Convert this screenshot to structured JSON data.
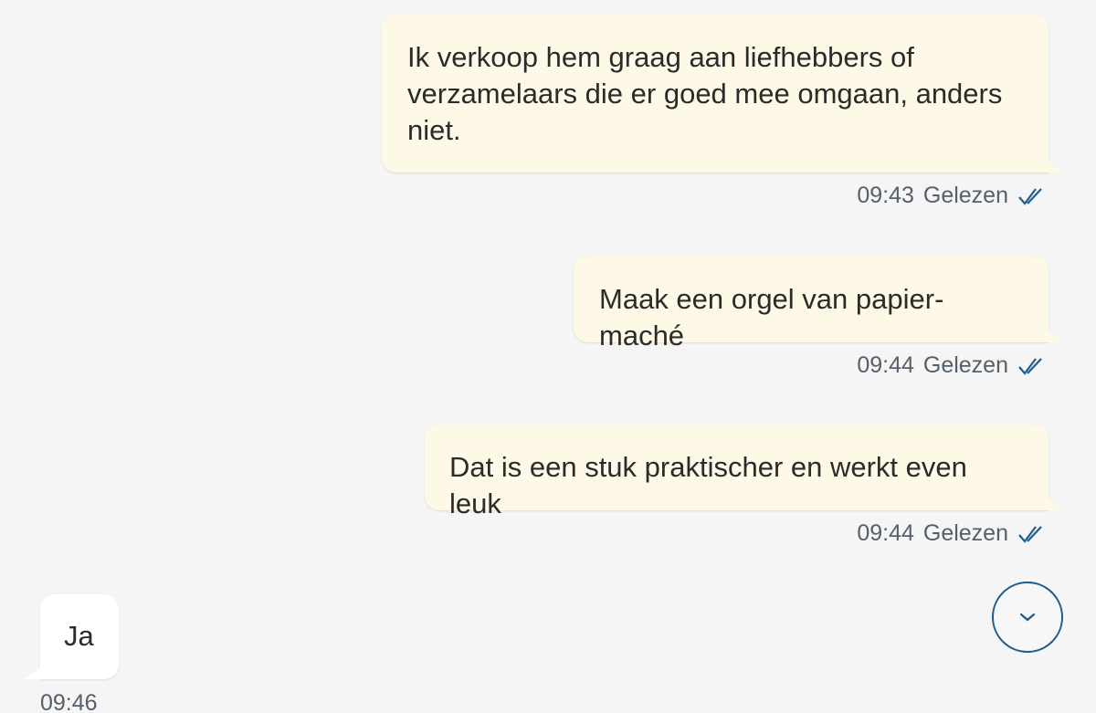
{
  "messages": [
    {
      "direction": "outgoing",
      "text": "Ik verkoop hem graag aan liefhebbers of verzamelaars die er goed mee omgaan, anders niet.",
      "time": "09:43",
      "status": "Gelezen"
    },
    {
      "direction": "outgoing",
      "text": "Maak een orgel van papier-maché",
      "time": "09:44",
      "status": "Gelezen"
    },
    {
      "direction": "outgoing",
      "text": "Dat is een stuk praktischer en werkt even leuk",
      "time": "09:44",
      "status": "Gelezen"
    },
    {
      "direction": "incoming",
      "text": "Ja",
      "time": "09:46"
    }
  ],
  "scroll_button": {
    "icon": "chevron-down-icon"
  },
  "colors": {
    "outgoing_bubble": "#fdf9e6",
    "incoming_bubble": "#ffffff",
    "read_ticks": "#1f5d8a",
    "background": "#f5f5f5"
  }
}
